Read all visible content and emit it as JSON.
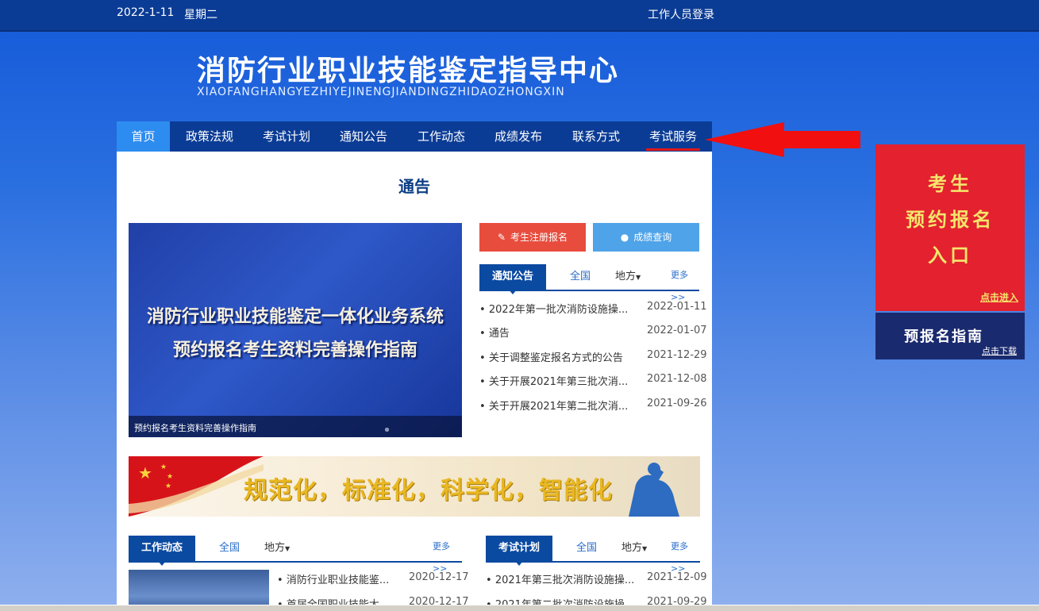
{
  "topbar": {
    "date": "2022-1-11",
    "weekday": "星期二",
    "staff_login": "工作人员登录"
  },
  "header": {
    "title": "消防行业职业技能鉴定指导中心",
    "subtitle": "XIAOFANGHANGYEZHIYEJINENGJIANDINGZHIDAOZHONGXIN"
  },
  "nav": {
    "items": [
      "首页",
      "政策法规",
      "考试计划",
      "通知公告",
      "工作动态",
      "成绩发布",
      "联系方式",
      "考试服务"
    ],
    "active_index": 0
  },
  "notice": {
    "title": "通告"
  },
  "banner": {
    "line1": "消防行业职业技能鉴定一体化业务系统",
    "line2": "预约报名考生资料完善操作指南",
    "caption": "预约报名考生资料完善操作指南",
    "slides": 5,
    "active_slide": 2
  },
  "buttons": {
    "register": "考生注册报名",
    "score_query": "成绩查询"
  },
  "notices_panel": {
    "tab_active": "通知公告",
    "tab_national": "全国",
    "tab_local": "地方",
    "more": "更多>>",
    "items": [
      {
        "title": "2022年第一批次消防设施操...",
        "date": "2022-01-11"
      },
      {
        "title": "通告",
        "date": "2022-01-07"
      },
      {
        "title": "关于调整鉴定报名方式的公告",
        "date": "2021-12-29"
      },
      {
        "title": "关于开展2021年第三批次消...",
        "date": "2021-12-08"
      },
      {
        "title": "关于开展2021年第二批次消...",
        "date": "2021-09-26"
      }
    ]
  },
  "slogan": {
    "text": "规范化，标准化，科学化，智能化"
  },
  "work_panel": {
    "tab_active": "工作动态",
    "tab_national": "全国",
    "tab_local": "地方",
    "more": "更多>>",
    "items": [
      {
        "title": "消防行业职业技能鉴...",
        "date": "2020-12-17"
      },
      {
        "title": "首届全国职业技能大...",
        "date": "2020-12-17"
      }
    ]
  },
  "plan_panel": {
    "tab_active": "考试计划",
    "tab_national": "全国",
    "tab_local": "地方",
    "more": "更多>>",
    "items": [
      {
        "title": "2021年第三批次消防设施操...",
        "date": "2021-12-09"
      },
      {
        "title": "2021年第二批次消防设施操...",
        "date": "2021-09-29"
      }
    ]
  },
  "side_ad": {
    "line1": "考生",
    "line2": "预约报名",
    "line3": "入口",
    "enter": "点击进入"
  },
  "side_guide": {
    "title": "预报名指南",
    "download": "点击下载"
  },
  "colors": {
    "nav_bg": "#0b3c95",
    "nav_active": "#2d8cf0",
    "accent_red": "#e3212f",
    "tab_blue": "#0b4aa1"
  }
}
